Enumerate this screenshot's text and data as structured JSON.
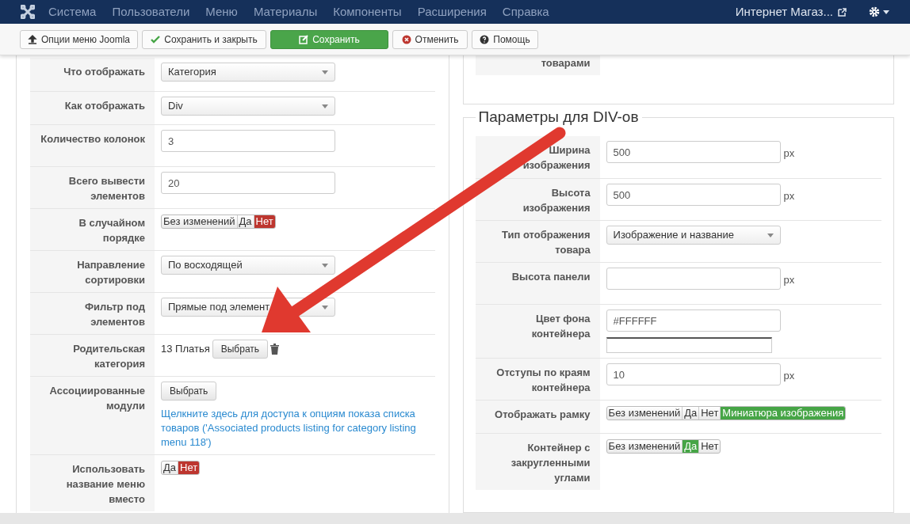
{
  "menu": [
    "Система",
    "Пользователи",
    "Меню",
    "Материалы",
    "Компоненты",
    "Расширения",
    "Справка"
  ],
  "site_link": "Интернет Магаз...",
  "toolbar": [
    {
      "label": "Опции меню Joomla",
      "kind": "upload"
    },
    {
      "label": "Сохранить и закрыть",
      "kind": "check"
    },
    {
      "label": "Сохранить",
      "kind": "save"
    },
    {
      "label": "Отменить",
      "kind": "cancel"
    },
    {
      "label": "Помощь",
      "kind": "help"
    }
  ],
  "left_form": {
    "rows": [
      {
        "label": "Что отображать",
        "kind": "select",
        "value": "Категория"
      },
      {
        "label": "Как отображать",
        "kind": "select",
        "value": "Div"
      },
      {
        "label": "Количество колонок",
        "kind": "text",
        "value": "3"
      },
      {
        "label": "Всего вывести элементов",
        "kind": "text",
        "value": "20"
      },
      {
        "label": "В случайном порядке",
        "kind": "toggle",
        "options": [
          {
            "label": "Без изменений",
            "selected": false
          },
          {
            "label": "Да",
            "selected": false
          },
          {
            "label": "Нет",
            "selected": true
          }
        ],
        "color": "#bd362f"
      },
      {
        "label": "Направление сортировки",
        "kind": "select",
        "value": "По восходящей"
      },
      {
        "label": "Фильтр под элементов",
        "kind": "select",
        "value": "Прямые под элемент"
      },
      {
        "label": "Родительская категория",
        "kind": "category",
        "value": "13 Платья",
        "button": "Выбрать"
      },
      {
        "label": "Ассоциированные модули",
        "kind": "modules",
        "button": "Выбрать",
        "link": "Щелкните здесь для доступа к опциям показа списка товаров ('Associated products listing for category listing menu 118')"
      },
      {
        "label": "Использовать название меню вместо",
        "kind": "toggle",
        "options": [
          {
            "label": "Да",
            "selected": false
          },
          {
            "label": "Нет",
            "selected": true
          }
        ],
        "color": "#bd362f"
      }
    ]
  },
  "right_form": {
    "top_label": "товарами",
    "legend": "Параметры для DIV-ов",
    "rows": [
      {
        "label": "Ширина изображения",
        "kind": "unit",
        "value": "500",
        "unit": "px"
      },
      {
        "label": "Высота изображения",
        "kind": "unit",
        "value": "500",
        "unit": "px"
      },
      {
        "label": "Тип отображения товара",
        "kind": "select",
        "value": "Изображение и название"
      },
      {
        "label": "Высота панели",
        "kind": "unit",
        "unit": "px"
      },
      {
        "label": "Цвет фона контейнера",
        "kind": "color",
        "value": "#FFFFFF"
      },
      {
        "label": "Отступы по краям контейнера",
        "kind": "unit",
        "value": "10",
        "unit": "px"
      },
      {
        "label": "Отображать рамку",
        "kind": "toggle",
        "options": [
          {
            "label": "Без изменений",
            "selected": false
          },
          {
            "label": "Да",
            "selected": false
          },
          {
            "label": "Нет",
            "selected": false
          },
          {
            "label": "Миниатюра изображения",
            "selected": true
          }
        ],
        "color": "#46a546"
      },
      {
        "label": "Контейнер с закругленными углами",
        "kind": "toggle",
        "options": [
          {
            "label": "Без изменений",
            "selected": false
          },
          {
            "label": "Да",
            "selected": true
          },
          {
            "label": "Нет",
            "selected": false
          }
        ],
        "color": "#46a546"
      }
    ]
  }
}
